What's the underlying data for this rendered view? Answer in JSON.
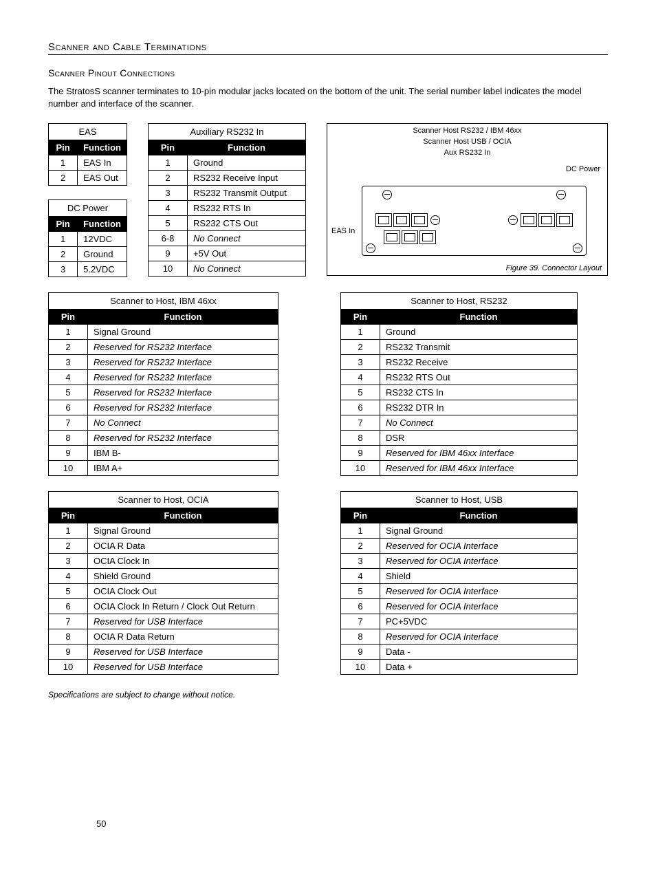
{
  "sectionTitle": "Scanner and Cable Terminations",
  "subsectionTitle": "Scanner Pinout Connections",
  "intro": "The StratosS scanner terminates to 10-pin modular jacks located on the bottom of the unit.  The serial number label indicates the model number and interface of the scanner.",
  "headers": {
    "pin": "Pin",
    "func": "Function"
  },
  "tables": {
    "eas": {
      "title": "EAS",
      "rows": [
        {
          "pin": "1",
          "func": "EAS In"
        },
        {
          "pin": "2",
          "func": "EAS Out"
        }
      ]
    },
    "dcpower": {
      "title": "DC Power",
      "rows": [
        {
          "pin": "1",
          "func": "12VDC"
        },
        {
          "pin": "2",
          "func": "Ground"
        },
        {
          "pin": "3",
          "func": "5.2VDC"
        }
      ]
    },
    "aux": {
      "title": "Auxiliary RS232 In",
      "rows": [
        {
          "pin": "1",
          "func": "Ground"
        },
        {
          "pin": "2",
          "func": "RS232 Receive Input"
        },
        {
          "pin": "3",
          "func": "RS232 Transmit Output"
        },
        {
          "pin": "4",
          "func": "RS232 RTS In"
        },
        {
          "pin": "5",
          "func": "RS232 CTS Out"
        },
        {
          "pin": "6-8",
          "func": "No Connect",
          "ital": true
        },
        {
          "pin": "9",
          "func": "+5V Out"
        },
        {
          "pin": "10",
          "func": "No Connect",
          "ital": true
        }
      ]
    },
    "ibm": {
      "title": "Scanner to Host, IBM 46xx",
      "rows": [
        {
          "pin": "1",
          "func": "Signal Ground"
        },
        {
          "pin": "2",
          "func": "Reserved for RS232 Interface",
          "ital": true
        },
        {
          "pin": "3",
          "func": "Reserved for RS232 Interface",
          "ital": true
        },
        {
          "pin": "4",
          "func": "Reserved for RS232 Interface",
          "ital": true
        },
        {
          "pin": "5",
          "func": "Reserved for RS232 Interface",
          "ital": true
        },
        {
          "pin": "6",
          "func": "Reserved for RS232 Interface",
          "ital": true
        },
        {
          "pin": "7",
          "func": "No Connect",
          "ital": true
        },
        {
          "pin": "8",
          "func": "Reserved for RS232 Interface",
          "ital": true
        },
        {
          "pin": "9",
          "func": "IBM B-"
        },
        {
          "pin": "10",
          "func": "IBM A+"
        }
      ]
    },
    "rs232": {
      "title": "Scanner to Host, RS232",
      "rows": [
        {
          "pin": "1",
          "func": "Ground"
        },
        {
          "pin": "2",
          "func": "RS232 Transmit"
        },
        {
          "pin": "3",
          "func": "RS232 Receive"
        },
        {
          "pin": "4",
          "func": "RS232 RTS Out"
        },
        {
          "pin": "5",
          "func": "RS232 CTS In"
        },
        {
          "pin": "6",
          "func": "RS232 DTR In"
        },
        {
          "pin": "7",
          "func": "No Connect",
          "ital": true
        },
        {
          "pin": "8",
          "func": "DSR"
        },
        {
          "pin": "9",
          "func": "Reserved for IBM 46xx Interface",
          "ital": true
        },
        {
          "pin": "10",
          "func": "Reserved for IBM 46xx Interface",
          "ital": true
        }
      ]
    },
    "ocia": {
      "title": "Scanner to Host, OCIA",
      "rows": [
        {
          "pin": "1",
          "func": "Signal Ground"
        },
        {
          "pin": "2",
          "func": "OCIA R Data"
        },
        {
          "pin": "3",
          "func": "OCIA Clock In"
        },
        {
          "pin": "4",
          "func": "Shield Ground"
        },
        {
          "pin": "5",
          "func": "OCIA Clock Out"
        },
        {
          "pin": "6",
          "func": "OCIA Clock In Return / Clock Out Return"
        },
        {
          "pin": "7",
          "func": "Reserved for USB Interface",
          "ital": true
        },
        {
          "pin": "8",
          "func": "OCIA R Data Return"
        },
        {
          "pin": "9",
          "func": "Reserved for USB Interface",
          "ital": true
        },
        {
          "pin": "10",
          "func": "Reserved for USB Interface",
          "ital": true
        }
      ]
    },
    "usb": {
      "title": "Scanner to Host, USB",
      "rows": [
        {
          "pin": "1",
          "func": "Signal Ground"
        },
        {
          "pin": "2",
          "func": "Reserved for OCIA Interface",
          "ital": true
        },
        {
          "pin": "3",
          "func": "Reserved for OCIA Interface",
          "ital": true
        },
        {
          "pin": "4",
          "func": "Shield"
        },
        {
          "pin": "5",
          "func": "Reserved for OCIA Interface",
          "ital": true
        },
        {
          "pin": "6",
          "func": "Reserved for OCIA Interface",
          "ital": true
        },
        {
          "pin": "7",
          "func": "PC+5VDC"
        },
        {
          "pin": "8",
          "func": "Reserved for OCIA Interface",
          "ital": true
        },
        {
          "pin": "9",
          "func": "Data -"
        },
        {
          "pin": "10",
          "func": "Data +"
        }
      ]
    }
  },
  "diagram": {
    "labels": {
      "top1": "Scanner Host RS232 / IBM 46xx",
      "top2": "Scanner Host USB / OCIA",
      "top3": "Aux RS232 In",
      "right": "DC Power",
      "left": "EAS In"
    },
    "caption": "Figure 39. Connector Layout"
  },
  "footnote": "Specifications are subject to change without notice.",
  "pageNumber": "50"
}
